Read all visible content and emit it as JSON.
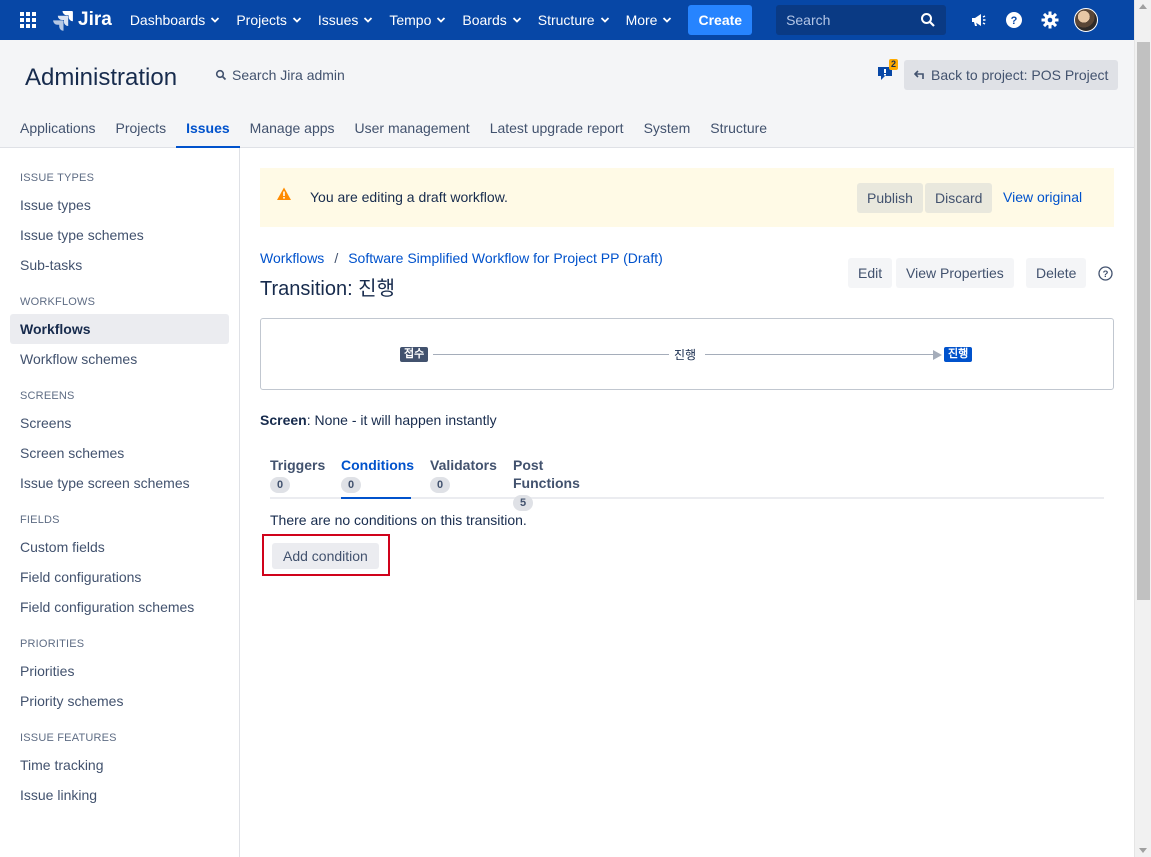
{
  "topnav": {
    "logo": "Jira",
    "items": [
      "Dashboards",
      "Projects",
      "Issues",
      "Tempo",
      "Boards",
      "Structure",
      "More"
    ],
    "create_label": "Create",
    "search_placeholder": "Search",
    "icons": [
      "app-switcher-icon",
      "notifications-megaphone-icon",
      "help-icon",
      "settings-gear-icon",
      "avatar"
    ]
  },
  "admin": {
    "title": "Administration",
    "search_label": "Search Jira admin",
    "notification_count": "2",
    "back_button": "Back to project: POS Project",
    "tabs": [
      "Applications",
      "Projects",
      "Issues",
      "Manage apps",
      "User management",
      "Latest upgrade report",
      "System",
      "Structure"
    ],
    "active_tab": "Issues"
  },
  "sidebar": {
    "sections": [
      {
        "heading": "ISSUE TYPES",
        "items": [
          "Issue types",
          "Issue type schemes",
          "Sub-tasks"
        ]
      },
      {
        "heading": "WORKFLOWS",
        "items": [
          "Workflows",
          "Workflow schemes"
        ]
      },
      {
        "heading": "SCREENS",
        "items": [
          "Screens",
          "Screen schemes",
          "Issue type screen schemes"
        ]
      },
      {
        "heading": "FIELDS",
        "items": [
          "Custom fields",
          "Field configurations",
          "Field configuration schemes"
        ]
      },
      {
        "heading": "PRIORITIES",
        "items": [
          "Priorities",
          "Priority schemes"
        ]
      },
      {
        "heading": "ISSUE FEATURES",
        "items": [
          "Time tracking",
          "Issue linking"
        ]
      }
    ],
    "active_item": "Workflows"
  },
  "banner": {
    "text": "You are editing a draft workflow.",
    "publish": "Publish",
    "discard": "Discard",
    "view_original": "View original"
  },
  "breadcrumb": {
    "root": "Workflows",
    "sep": "/",
    "current": "Software Simplified Workflow for Project PP (Draft)"
  },
  "page": {
    "title": "Transition: 진행",
    "edit": "Edit",
    "view_properties": "View Properties",
    "delete": "Delete"
  },
  "diagram": {
    "from_status": "접수",
    "transition": "진행",
    "to_status": "진행"
  },
  "screen": {
    "label": "Screen",
    "value": ": None - it will happen instantly"
  },
  "tabs": [
    {
      "label": "Triggers",
      "count": "0"
    },
    {
      "label": "Conditions",
      "count": "0"
    },
    {
      "label": "Validators",
      "count": "0"
    },
    {
      "label": "Post Functions",
      "count": "5"
    }
  ],
  "active_tab": "Conditions",
  "conditions": {
    "empty_text": "There are no conditions on this transition.",
    "add_button": "Add condition"
  },
  "colors": {
    "nav_bg": "#0747a6",
    "create_bg": "#2684ff",
    "link": "#0052cc",
    "banner_bg": "#fffae6",
    "highlight_border": "#d0021b"
  }
}
